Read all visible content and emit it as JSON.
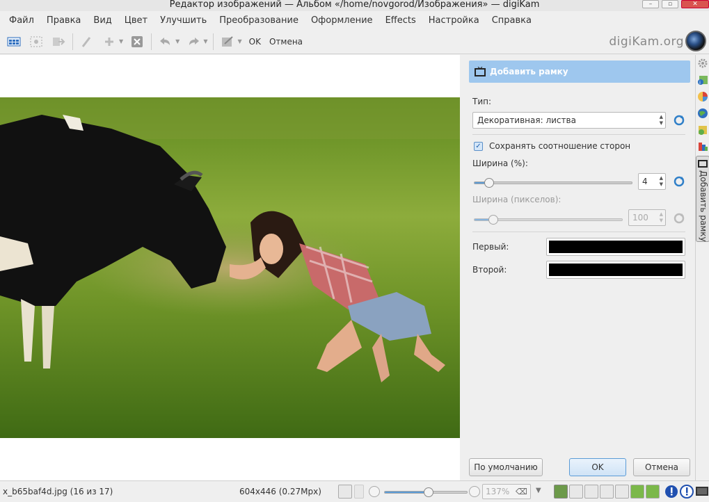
{
  "window": {
    "title": "Редактор изображений — Альбом «/home/novgorod/Изображения» — digiKam"
  },
  "menu": [
    "Файл",
    "Правка",
    "Вид",
    "Цвет",
    "Улучшить",
    "Преобразование",
    "Оформление",
    "Effects",
    "Настройка",
    "Справка"
  ],
  "toolbar": {
    "ok_label": "OK",
    "cancel_label": "Отмена",
    "brand": "digiKam.org"
  },
  "tool": {
    "title": "Добавить рамку",
    "type_label": "Тип:",
    "type_value": "Декоративная: листва",
    "keep_ratio_label": "Сохранять соотношение сторон",
    "keep_ratio_checked": true,
    "width_pct_label": "Ширина (%):",
    "width_pct_value": "4",
    "width_pct_level": 0.04,
    "width_px_label": "Ширина (пикселов):",
    "width_px_value": "100",
    "first_label": "Первый:",
    "first_color": "#000000",
    "second_label": "Второй:",
    "second_color": "#000000",
    "default_button": "По умолчанию",
    "ok_button": "OK",
    "cancel_button": "Отмена"
  },
  "sidebar": {
    "tab_label": "Добавить рамку"
  },
  "status": {
    "filename": "x_b65baf4d.jpg (16 из 17)",
    "dimensions": "604x446 (0.27Mpx)",
    "zoom": "137%"
  },
  "colors": {
    "accent": "#9ec7ee",
    "slider": "#5b9bd6"
  }
}
